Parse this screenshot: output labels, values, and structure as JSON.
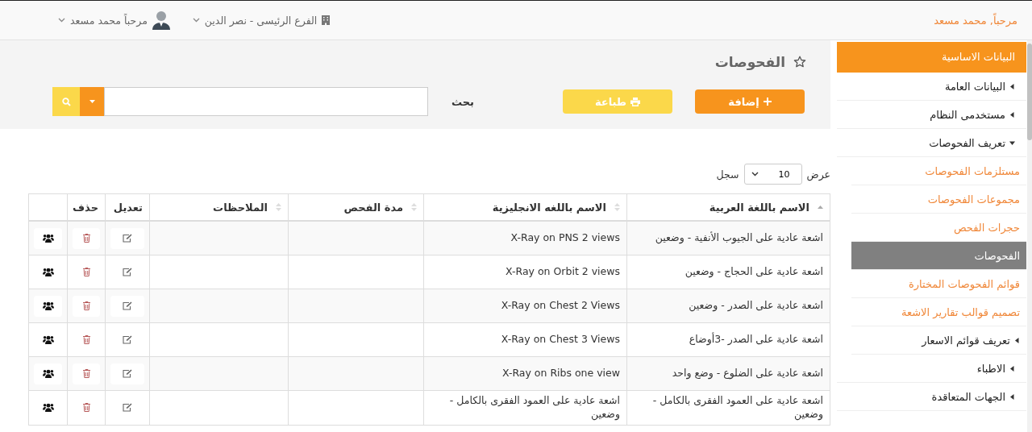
{
  "header": {
    "greeting": "مرحباً, محمد مسعد",
    "branch": "الفرع الرئيسى - نصر الدين",
    "user": "مرحباً محمد مسعد"
  },
  "sidebar": {
    "title": "البيانات الاساسية",
    "items": [
      {
        "label": "البيانات العامة",
        "kind": "group",
        "expanded": false
      },
      {
        "label": "مستخدمى النظام",
        "kind": "group",
        "expanded": false
      },
      {
        "label": "تعريف الفحوصات",
        "kind": "group",
        "expanded": true,
        "children": [
          {
            "label": "مستلزمات الفحوصات",
            "kind": "link",
            "selected": false
          },
          {
            "label": "مجموعات الفحوصات",
            "kind": "link",
            "selected": false
          },
          {
            "label": "حجرات الفحص",
            "kind": "link",
            "selected": false
          },
          {
            "label": "الفحوصات",
            "kind": "link",
            "selected": true
          },
          {
            "label": "قوائم الفحوصات المختارة",
            "kind": "link",
            "selected": false
          },
          {
            "label": "تصميم قوالب تقارير الاشعة",
            "kind": "link",
            "selected": false
          },
          {
            "label": "تعريف قوائم الاسعار",
            "kind": "group",
            "expanded": false
          }
        ]
      },
      {
        "label": "الاطباء",
        "kind": "group",
        "expanded": false
      },
      {
        "label": "الجهات المتعاقدة",
        "kind": "group",
        "expanded": false
      }
    ]
  },
  "page": {
    "title": "الفحوصات",
    "buttons": [
      {
        "label": "إضافة",
        "kind": "add"
      },
      {
        "label": "طباعة",
        "kind": "print"
      }
    ],
    "search_label": "بحث"
  },
  "length": {
    "prefix": "عرض",
    "value": "10",
    "suffix": "سجل"
  },
  "table": {
    "columns": [
      {
        "label": "الاسم باللغة العربية",
        "kind": "data",
        "sorted": true
      },
      {
        "label": "الاسم باللغه الانجليزية",
        "kind": "data",
        "sorted": false
      },
      {
        "label": "مدة الفحص",
        "kind": "data",
        "sorted": false
      },
      {
        "label": "الملاحظات",
        "kind": "data",
        "sorted": false
      },
      {
        "label": "تعديل",
        "kind": "edit"
      },
      {
        "label": "حذف",
        "kind": "delete"
      },
      {
        "kind": "members"
      }
    ],
    "rows": [
      {
        "name_ar": "اشعة عادية على الجيوب الأنفية - وضعين",
        "name_en": "X-Ray on PNS 2 views"
      },
      {
        "name_ar": "اشعة عادية على الحجاج - وضعين",
        "name_en": "X-Ray on Orbit 2 views"
      },
      {
        "name_ar": "اشعة عادية على الصدر - وضعين",
        "name_en": "X-Ray on Chest 2 Views"
      },
      {
        "name_ar": "اشعة عادية على الصدر -3أوضاع",
        "name_en": "X-Ray on Chest 3 Views"
      },
      {
        "name_ar": "اشعة عادية على الضلوع - وضع واحد",
        "name_en": "X-Ray on Ribs one view"
      },
      {
        "name_ar": "اشعة عادية على العمود الفقرى بالكامل - وضعين",
        "name_en": "اشعة عادية على العمود الفقرى بالكامل - وضعين"
      }
    ]
  }
}
